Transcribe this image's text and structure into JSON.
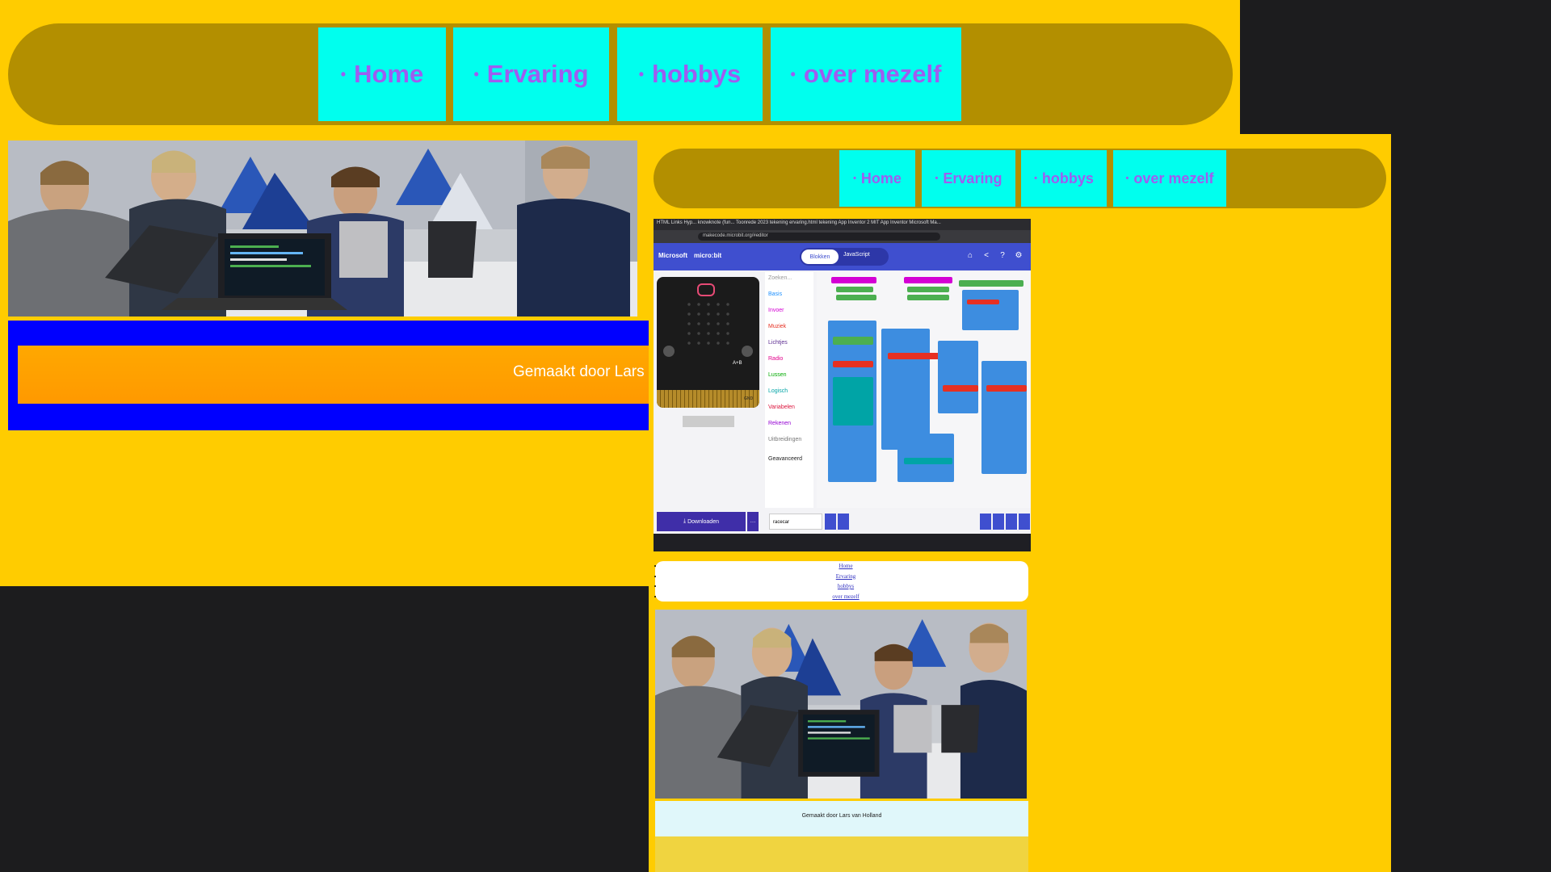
{
  "nav": {
    "items": [
      "Home",
      "Ervaring",
      "hobbys",
      "over mezelf"
    ],
    "bullet": "•"
  },
  "footer": {
    "text": "Gemaakt door Lars van Holland",
    "text_visible_outer": "Gemaakt door Lars v"
  },
  "screenshot": {
    "tab_strip": "HTML Links Hyp...   knowknote (fun...   Toonrede 2023   tekening   ervaring.html   tekening   App Inventor 2   MIT App Inventor   Microsoft Ma...",
    "url": "makecode.microbit.org/#editor",
    "brand_microsoft": "Microsoft",
    "brand_microbit": "micro:bit",
    "tab_blokken": "Blokken",
    "tab_javascript": "JavaScript",
    "search_placeholder": "Zoeken...",
    "categories": [
      "Basis",
      "Invoer",
      "Muziek",
      "Lichtjes",
      "Radio",
      "Lussen",
      "Logisch",
      "Variabelen",
      "Rekenen",
      "Uitbreidingen",
      "Geavanceerd"
    ],
    "download_label": "Downloaden",
    "project_name": "racecar",
    "microbit_label": "A+B",
    "gnd_label": "GND"
  },
  "colors": {
    "page_bg": "#ffcc00",
    "nav_bar": "#b38f00",
    "nav_item_bg": "#00ffee",
    "nav_item_text": "#9f5cf0",
    "footer_outer": "#0000ff",
    "footer_inner": "#ff9900",
    "desktop_bg": "#1c1c1e"
  },
  "icons": [
    "home-icon",
    "share-icon",
    "help-icon",
    "settings-icon",
    "download-icon",
    "undo-icon",
    "redo-icon",
    "zoom-in-icon",
    "zoom-out-icon"
  ]
}
